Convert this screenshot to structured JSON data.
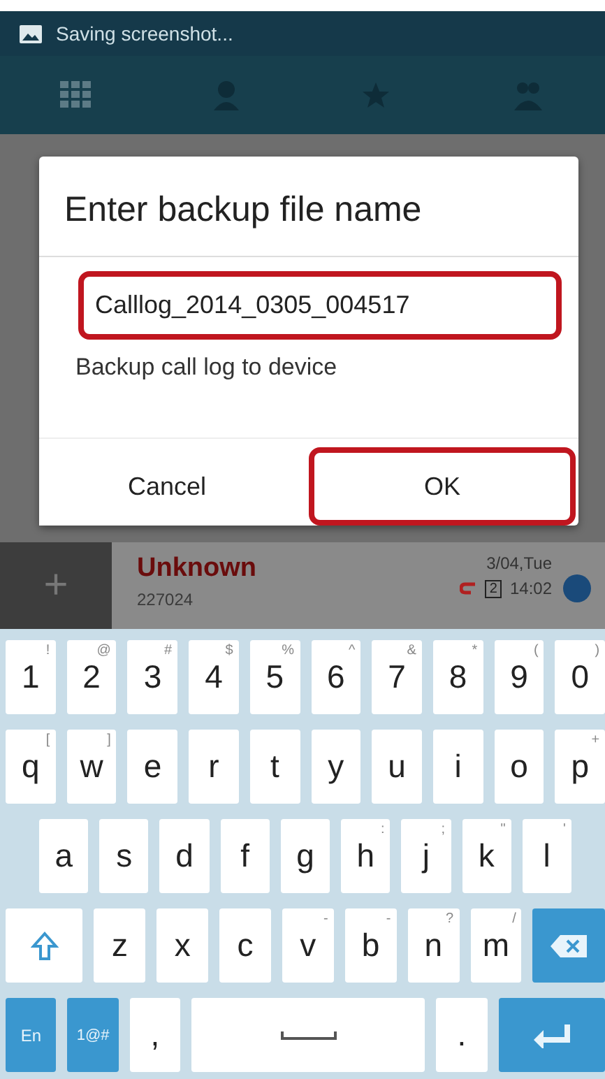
{
  "status_bar": {
    "notification": "Saving screenshot..."
  },
  "background_list": {
    "row": {
      "name": "Unknown",
      "number": "227024",
      "date": "3/04,Tue",
      "time": "14:02",
      "sim": "2"
    },
    "add_label": "+"
  },
  "dialog": {
    "title": "Enter backup file name",
    "field": {
      "value": "Calllog_2014_0305_004517",
      "highlighted": true
    },
    "note": "Backup call log to device",
    "buttons": [
      {
        "label": "Cancel",
        "highlighted": false
      },
      {
        "label": "OK",
        "highlighted": true
      }
    ]
  },
  "keyboard": {
    "rows": [
      [
        {
          "kind": "char",
          "label": "1",
          "hint": "!"
        },
        {
          "kind": "char",
          "label": "2",
          "hint": "@"
        },
        {
          "kind": "char",
          "label": "3",
          "hint": "#"
        },
        {
          "kind": "char",
          "label": "4",
          "hint": "$"
        },
        {
          "kind": "char",
          "label": "5",
          "hint": "%"
        },
        {
          "kind": "char",
          "label": "6",
          "hint": "^"
        },
        {
          "kind": "char",
          "label": "7",
          "hint": "&"
        },
        {
          "kind": "char",
          "label": "8",
          "hint": "*"
        },
        {
          "kind": "char",
          "label": "9",
          "hint": "("
        },
        {
          "kind": "char",
          "label": "0",
          "hint": ")"
        }
      ],
      [
        {
          "kind": "char",
          "label": "q",
          "hint": "["
        },
        {
          "kind": "char",
          "label": "w",
          "hint": "]"
        },
        {
          "kind": "char",
          "label": "e"
        },
        {
          "kind": "char",
          "label": "r"
        },
        {
          "kind": "char",
          "label": "t"
        },
        {
          "kind": "char",
          "label": "y"
        },
        {
          "kind": "char",
          "label": "u"
        },
        {
          "kind": "char",
          "label": "i"
        },
        {
          "kind": "char",
          "label": "o"
        },
        {
          "kind": "char",
          "label": "p",
          "hint": "+"
        }
      ],
      [
        {
          "kind": "char",
          "label": "a"
        },
        {
          "kind": "char",
          "label": "s"
        },
        {
          "kind": "char",
          "label": "d"
        },
        {
          "kind": "char",
          "label": "f"
        },
        {
          "kind": "char",
          "label": "g"
        },
        {
          "kind": "char",
          "label": "h",
          "hint": ":"
        },
        {
          "kind": "char",
          "label": "j",
          "hint": ";"
        },
        {
          "kind": "char",
          "label": "k",
          "hint": "\""
        },
        {
          "kind": "char",
          "label": "l",
          "hint": "'"
        }
      ],
      [
        {
          "kind": "shift"
        },
        {
          "kind": "char",
          "label": "z"
        },
        {
          "kind": "char",
          "label": "x"
        },
        {
          "kind": "char",
          "label": "c"
        },
        {
          "kind": "char",
          "label": "v",
          "hint": "-"
        },
        {
          "kind": "char",
          "label": "b",
          "hint": "-"
        },
        {
          "kind": "char",
          "label": "n",
          "hint": "?"
        },
        {
          "kind": "char",
          "label": "m",
          "hint": "/"
        },
        {
          "kind": "backspace"
        }
      ],
      [
        {
          "kind": "lang",
          "label": "En"
        },
        {
          "kind": "symbols",
          "label": "1@#"
        },
        {
          "kind": "char",
          "label": ","
        },
        {
          "kind": "space"
        },
        {
          "kind": "char",
          "label": "."
        },
        {
          "kind": "enter"
        }
      ]
    ]
  }
}
